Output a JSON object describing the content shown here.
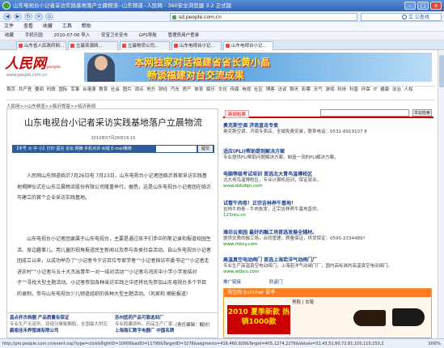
{
  "window": {
    "title": "山东电视台小记者采访实践基地落户立晨物流--山东频道--人民网 - 360安全浏览器 3.2 正式版",
    "min": "–",
    "max": "□",
    "close": "×"
  },
  "address": {
    "url": "sd.people.com.cn",
    "search_label": "立 公查找"
  },
  "menu": [
    "文件",
    "查看",
    "收藏",
    "工具",
    "帮助"
  ],
  "favorites": [
    "收藏",
    "手机乐园",
    "2010-07-06 导入",
    "安宝卫长安市",
    "GPS导航",
    "管理员用户登录"
  ],
  "tabs": [
    "山东省人民政府网...",
    "立晨资源网...",
    "立晨物流公司...",
    "山东电视台小记...",
    "山东电视台小记..."
  ],
  "site": {
    "logo": "人民网",
    "logo_sub": "people",
    "logo_url": "www.people.com.cn"
  },
  "banner": {
    "line1": "本网独家对话福建省省长黄小晶",
    "line2": "畅谈福建对台交流成果"
  },
  "channel_nav": "首页 共产党 要闻 时政 国际 军事 台港澳 教育 社会 图片 观点 地方 财经 汽车 房产 体育 娱乐 文化 传媒 电视 社区 博客 访谈 聊天 彩票 天气 游戏 科技 科普 环保 IT 健康 法治 人权",
  "breadcrumb": "人民网>>山东频道>>临沂视窗>>临沂新闻",
  "article": {
    "title": "山东电视台小记者采访实践基地落户立晨物流",
    "date": "2010年07月26日16:15",
    "tools": "【字号 大 中 小】打印 留言 论坛 网摘 手机点评 纠错  E-mail推荐",
    "tools_button": "提交",
    "p1": "人民网山东频道临沂7月26日电 7月23日，山东电视台小记者团临沂首家采访实践基地揭牌仪式在山东立晨物流股份有限公司隆重举行。据悉，这是山东电视台小记者团在临沂市建立的首个企业采访实践基地。",
    "p2": "山东电视台小记者团隶属于山东电视台，主要是通过孩子们手中的笔记录和报道校园生活、身边趣事儿。用儿童的视角报道民生新闻以及参与各类社会活动。自山东电视台小记者团成立以来，以成功举办了“小记者今夕访百位专家学者”“小记者探访市委书记”“小记者走进农村”“小记者与五十大杰出青年一对一结对活动”“小记者与鸿庆中小学小学发结对子”“寻找大型主题活动。小记者参加各种采访实践之中还将优先参加山东电视台多个节目的录制，参与山东电视台少儿频道组织的各种大型主题活动。（巩家和 摘影报道）",
    "editor": "（责任编辑：解欣）"
  },
  "bottom_ads": [
    {
      "title": "昌点杯杰档圈 产品质量有保证",
      "desc": "专业生产无溶剂、双组分聚氨酯胶，全国最大供应商...",
      "url": "www.xxxx.com"
    },
    {
      "title": "苏州医药产品可靠选到厂",
      "desc": "专业胶囊原料、药品生产厂家...",
      "url": "www.xxxx.com"
    },
    {
      "title": "蔚南佳禾养殖城有限公司",
      "desc": "专业生产吊兰草、鹅掌柴盆栽植物..."
    },
    {
      "title": "上海南汇数字电器厂 中国名牌",
      "desc": "专业生产各类电器产品..."
    }
  ],
  "right": {
    "search_label": "新闻检索",
    "search_button": "本站检索",
    "ads": [
      {
        "title": "奥克斯空调 济南直击专卖",
        "desc": "奥克斯空调，济南专卖店，全城免费安装，联系电话：0531-8919107 8",
        "url": ""
      },
      {
        "title": "适应(PLI)帮助提到解决方案",
        "desc": "专业提供PLI帮助问题解决方案，制造一流的PLI解决方案。",
        "url": ""
      },
      {
        "title": "电脑等级考试培训 首选北大青鸟温博校区",
        "desc": "北大青鸟温博校区，专业计算机培训，保证就业。",
        "url": "www.dzbdqn.com"
      },
      {
        "title": "试看牛肉卷！正宗吉林养牛基地！",
        "desc": "吉林牛肉卷 - 牛肉批发，正宗吉林养牛基地直供。",
        "url": "123ntu.cn"
      },
      {
        "title": "潍坊云卖园 最好的融工场首选发展全辅材。",
        "desc": "提供优质的融工场，合同管理，质量保证，供货保证：0595-2334489?",
        "url": "www.mbsy.com"
      },
      {
        "title": "高温真空电动阀门 首选上海若洋气动阀门厂",
        "desc": "专业生产高温真空电动阀门，上海若洋气动阀门厂，国内高标准的高温真空电动阀门。",
        "url": "www.wtbcv.com"
      }
    ],
    "side_links": [
      "推广链接",
      "防盗门"
    ],
    "taobao": {
      "header": "淘宝网 Summer 夏季",
      "promo": "2010 夏季新款 热销1000款",
      "tabs": "男鞋 | 女鞋"
    }
  },
  "status": {
    "text": "http://pro.people.com.cn/event.nsp?type=click&flightID=10006&adID=11790&TargetID=3276&segments=416,460,928&Target=405,1274,2276&Values=31,43,51,60,72,81,100,110,150,2",
    "zoom": "100%"
  }
}
